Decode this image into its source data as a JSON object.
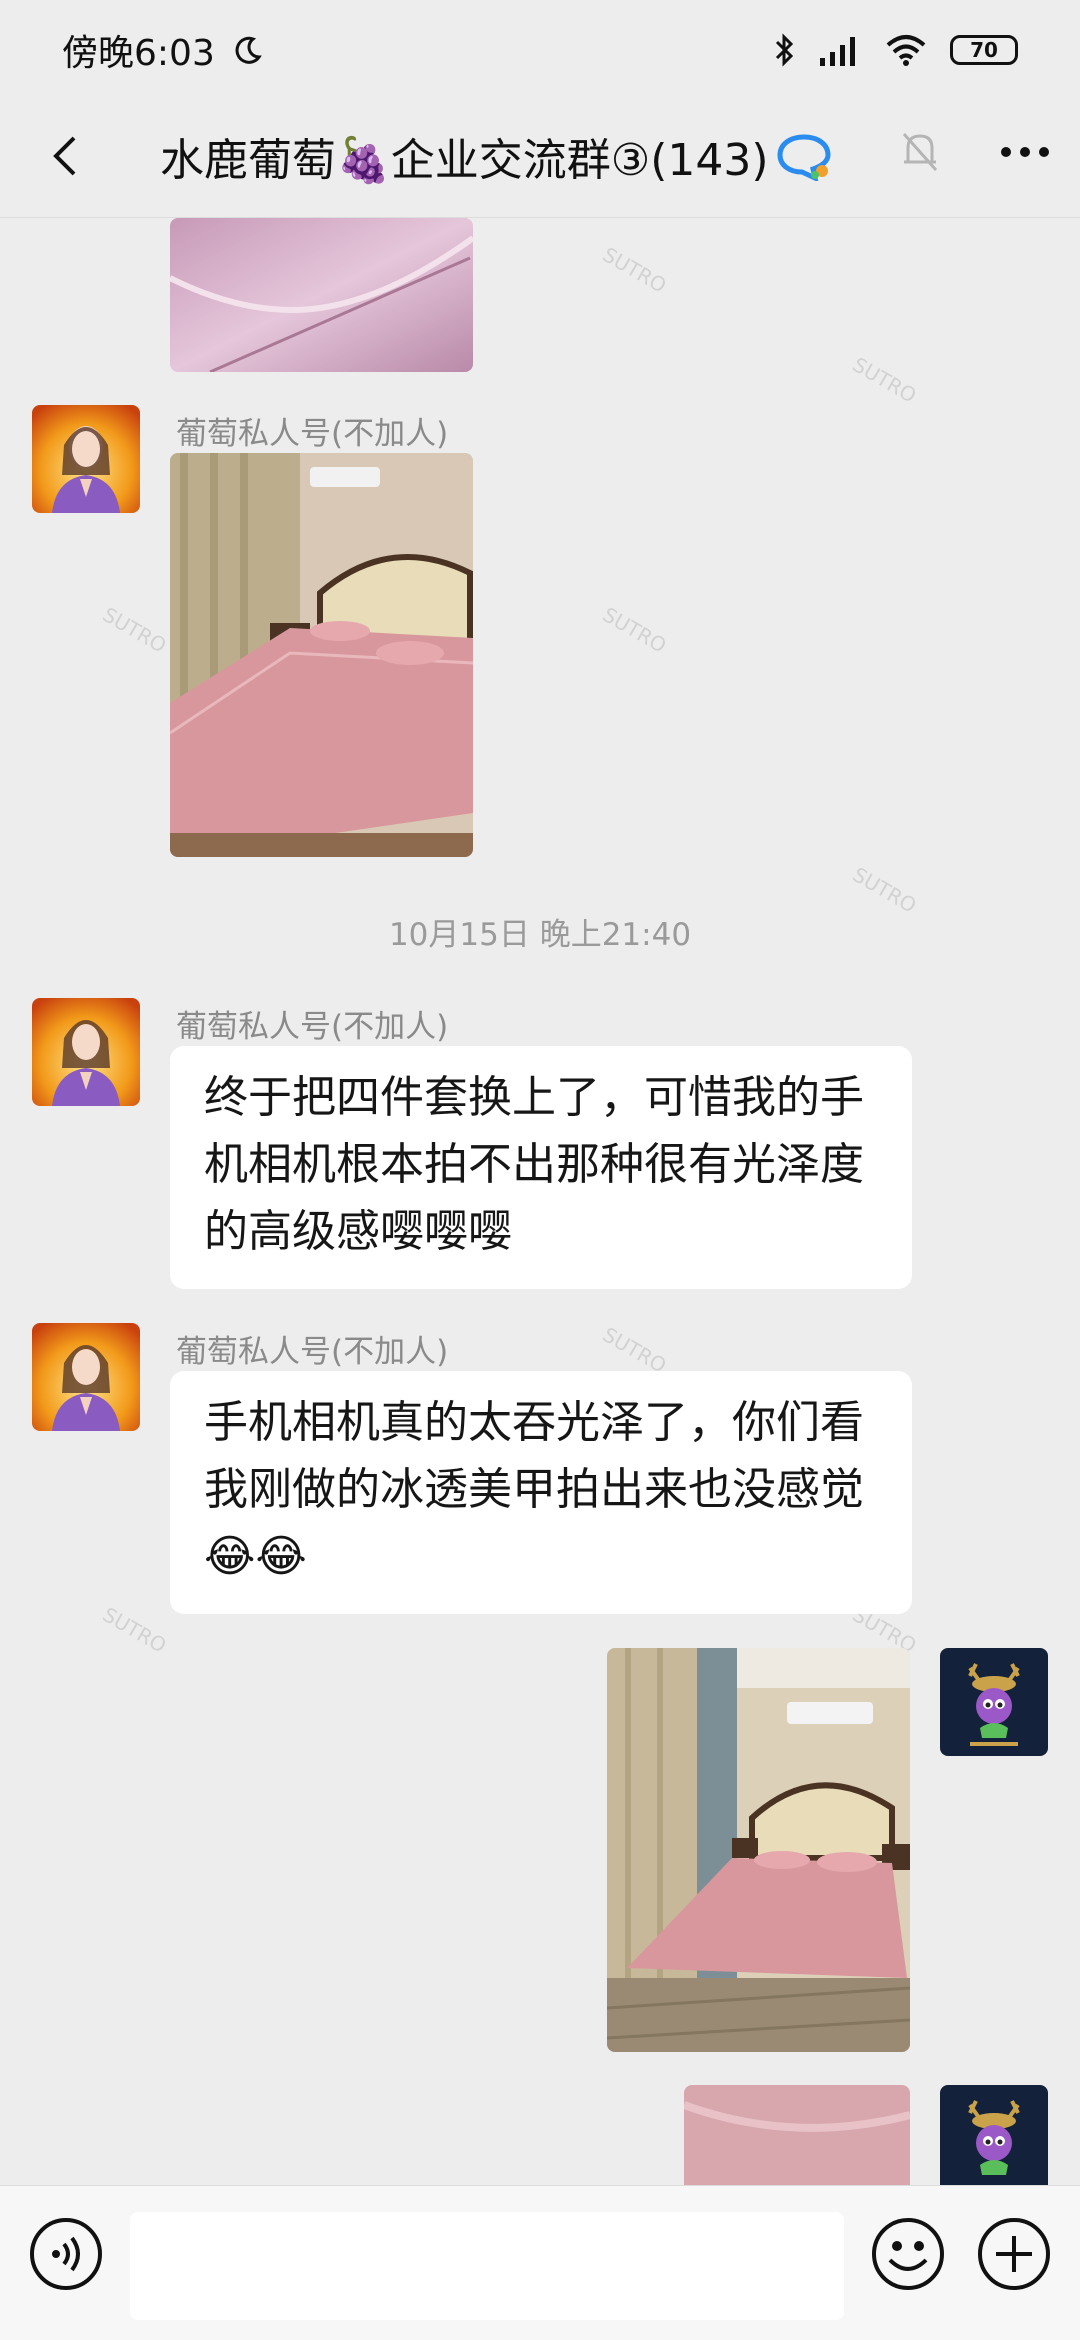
{
  "status_bar": {
    "time": "傍晚6:03",
    "battery": "70"
  },
  "header": {
    "title": "水鹿葡萄🍇企业交流群③(143)"
  },
  "messages": [
    {
      "sender": "葡萄私人号(不加人)"
    },
    {
      "timestamp": "10月15日 晚上21:40"
    },
    {
      "sender": "葡萄私人号(不加人)",
      "text": "终于把四件套换上了，可惜我的手机相机根本拍不出那种很有光泽度的高级感嘤嘤嘤"
    },
    {
      "sender": "葡萄私人号(不加人)",
      "text": "手机相机真的太吞光泽了，你们看我刚做的冰透美甲拍出来也没感觉😂😂"
    }
  ],
  "input": {
    "placeholder": ""
  },
  "colors": {
    "background": "#ededed",
    "bubble": "#ffffff",
    "sender_text": "#8a8a8a",
    "accent_blue": "#2b8cf0"
  },
  "icons": [
    "back-arrow-icon",
    "chat-bubble-icon",
    "mute-bell-icon",
    "more-icon",
    "voice-icon",
    "emoji-icon",
    "plus-icon"
  ]
}
